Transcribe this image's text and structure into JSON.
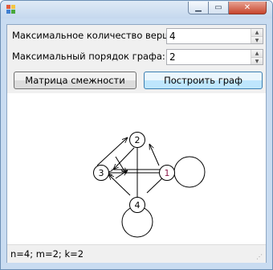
{
  "window": {
    "title": ""
  },
  "fields": {
    "max_vertices_label": "Максимальное количество вершин:",
    "max_vertices_value": "4",
    "max_order_label": "Максимальный порядок графа:",
    "max_order_value": "2"
  },
  "buttons": {
    "adjacency_matrix": "Матрица смежности",
    "build_graph": "Построить граф"
  },
  "graph": {
    "nodes": [
      {
        "id": "1",
        "label": "1"
      },
      {
        "id": "2",
        "label": "2"
      },
      {
        "id": "3",
        "label": "3"
      },
      {
        "id": "4",
        "label": "4"
      }
    ],
    "node_label_colors": {
      "1": "#8b1a4a",
      "2": "#000000",
      "3": "#000000",
      "4": "#000000"
    }
  },
  "status": {
    "text": "n=4; m=2; k=2"
  }
}
